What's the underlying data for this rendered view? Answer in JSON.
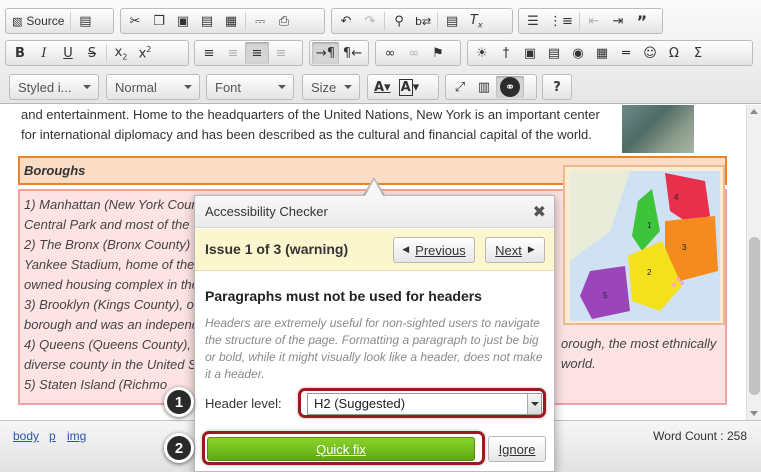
{
  "toolbar": {
    "row1": [
      {
        "name": "source-button",
        "icon": "source-icon",
        "glyph": "⌘",
        "label": "Source"
      },
      {
        "name": "templates-button",
        "icon": "document-icon",
        "glyph": "🗋"
      },
      {
        "name": "cut-button",
        "icon": "scissors-icon",
        "glyph": "✂"
      },
      {
        "name": "copy-button",
        "icon": "copy-icon",
        "glyph": "⎘"
      },
      {
        "name": "paste-button",
        "icon": "clipboard-icon",
        "glyph": "📋"
      },
      {
        "name": "paste-text-button",
        "icon": "clipboard-text-icon",
        "glyph": "📋"
      },
      {
        "name": "paste-word-button",
        "icon": "clipboard-word-icon",
        "glyph": "📋"
      },
      {
        "name": "preview-button",
        "icon": "preview-icon",
        "glyph": "🔍"
      },
      {
        "name": "print-button",
        "icon": "printer-icon",
        "glyph": "⎙"
      },
      {
        "name": "undo-button",
        "icon": "undo-icon",
        "glyph": "↶"
      },
      {
        "name": "redo-button",
        "icon": "redo-icon",
        "glyph": "↷"
      },
      {
        "name": "find-button",
        "icon": "search-icon",
        "glyph": "⌕"
      },
      {
        "name": "replace-button",
        "icon": "replace-icon",
        "glyph": "ab"
      },
      {
        "name": "select-all-button",
        "icon": "select-all-icon",
        "glyph": "≣"
      },
      {
        "name": "remove-format-button",
        "icon": "clear-format-icon",
        "glyph": "Tx"
      },
      {
        "name": "numbered-list-button",
        "icon": "numbered-list-icon",
        "glyph": "☰"
      },
      {
        "name": "bulleted-list-button",
        "icon": "bulleted-list-icon",
        "glyph": "≡"
      },
      {
        "name": "outdent-button",
        "icon": "outdent-icon",
        "glyph": "⇤"
      },
      {
        "name": "indent-button",
        "icon": "indent-icon",
        "glyph": "⇥"
      },
      {
        "name": "blockquote-button",
        "icon": "quote-icon",
        "glyph": "”"
      }
    ],
    "row2": [
      {
        "name": "bold-button",
        "icon": "bold-icon",
        "glyph": "B"
      },
      {
        "name": "italic-button",
        "icon": "italic-icon",
        "glyph": "I"
      },
      {
        "name": "underline-button",
        "icon": "underline-icon",
        "glyph": "U"
      },
      {
        "name": "strike-button",
        "icon": "strikethrough-icon",
        "glyph": "S"
      },
      {
        "name": "subscript-button",
        "icon": "subscript-icon",
        "glyph": "x₂"
      },
      {
        "name": "superscript-button",
        "icon": "superscript-icon",
        "glyph": "x²"
      },
      {
        "name": "align-left-button",
        "icon": "align-left-icon",
        "glyph": "≡"
      },
      {
        "name": "align-center-button",
        "icon": "align-center-icon",
        "glyph": "≡"
      },
      {
        "name": "align-right-button",
        "icon": "align-right-icon",
        "glyph": "≡"
      },
      {
        "name": "justify-button",
        "icon": "justify-icon",
        "glyph": "≡"
      },
      {
        "name": "ltr-button",
        "icon": "text-direction-ltr-icon",
        "glyph": "¶"
      },
      {
        "name": "rtl-button",
        "icon": "text-direction-rtl-icon",
        "glyph": "¶"
      },
      {
        "name": "link-button",
        "icon": "link-icon",
        "glyph": "∞"
      },
      {
        "name": "unlink-button",
        "icon": "unlink-icon",
        "glyph": "∅"
      },
      {
        "name": "anchor-button",
        "icon": "flag-icon",
        "glyph": "⚑"
      },
      {
        "name": "accessibility-button",
        "icon": "sun-icon",
        "glyph": "☀"
      },
      {
        "name": "pin-button",
        "icon": "pin-icon",
        "glyph": "†"
      },
      {
        "name": "image-button",
        "icon": "image-icon",
        "glyph": "▣"
      },
      {
        "name": "flash-button",
        "icon": "film-icon",
        "glyph": "▤"
      },
      {
        "name": "special-button",
        "icon": "compass-icon",
        "glyph": "◉"
      },
      {
        "name": "table-button",
        "icon": "table-icon",
        "glyph": "▦"
      },
      {
        "name": "horizontal-rule-button",
        "icon": "horizontal-rule-icon",
        "glyph": "═"
      },
      {
        "name": "smiley-button",
        "icon": "smiley-icon",
        "glyph": "☺"
      },
      {
        "name": "special-char-button",
        "icon": "omega-icon",
        "glyph": "Ω"
      },
      {
        "name": "sigma-button",
        "icon": "sigma-icon",
        "glyph": "Σ"
      }
    ],
    "row3": {
      "styles": "Styled i...",
      "format": "Normal",
      "font": "Font",
      "size": "Size",
      "buttons": [
        {
          "name": "text-color-button",
          "icon": "text-color-icon",
          "glyph": "A"
        },
        {
          "name": "bg-color-button",
          "icon": "background-color-icon",
          "glyph": "A"
        },
        {
          "name": "maximize-button",
          "icon": "maximize-icon",
          "glyph": "⤢"
        },
        {
          "name": "show-blocks-button",
          "icon": "show-blocks-icon",
          "glyph": "▥"
        },
        {
          "name": "accessibility-checker-button",
          "icon": "accessibility-icon",
          "glyph": "☺"
        },
        {
          "name": "help-button",
          "icon": "question-icon",
          "glyph": "?"
        }
      ]
    }
  },
  "content": {
    "intro": "and entertainment. Home to the headquarters of the United Nations, New York is an important center for international diplomacy and has been described as the cultural and financial capital of the world.",
    "boroughs_heading": "Boroughs",
    "borough_lines": [
      "1) Manhattan (New York Coun",
      "Central Park and most of the",
      "2) The Bronx (Bronx County) i",
      "Yankee Stadium, home of the",
      "owned housing complex in the",
      "3) Brooklyn (Kings County), o",
      "borough and was an independ",
      "4) Queens (Queens County), c",
      "diverse county in the United S",
      "5) Staten Island (Richmo"
    ],
    "borough_right_lines": [
      {
        "line": 7,
        "text": "orough, the most ethnically"
      },
      {
        "line": 8,
        "text": "world."
      }
    ],
    "map_labels": [
      "1",
      "2",
      "3",
      "4",
      "5"
    ]
  },
  "statusbar": {
    "crumbs": [
      "body",
      "p",
      "img"
    ],
    "word_count": "Word Count : 258"
  },
  "dialog": {
    "title": "Accessibility Checker",
    "close": "✖",
    "issue": "Issue 1 of 3 (warning)",
    "previous": "Previous",
    "next": "Next",
    "heading": "Paragraphs must not be used for headers",
    "description": "Headers are extremely useful for non-sighted users to navigate the structure of the page. Formatting a paragraph to just be big or bold, while it might visually look like a header, does not make it a header.",
    "header_level_label": "Header level:",
    "header_level_value": "H2 (Suggested)",
    "quick_fix": "Quick fix",
    "ignore": "Ignore"
  },
  "callouts": [
    "1",
    "2"
  ]
}
